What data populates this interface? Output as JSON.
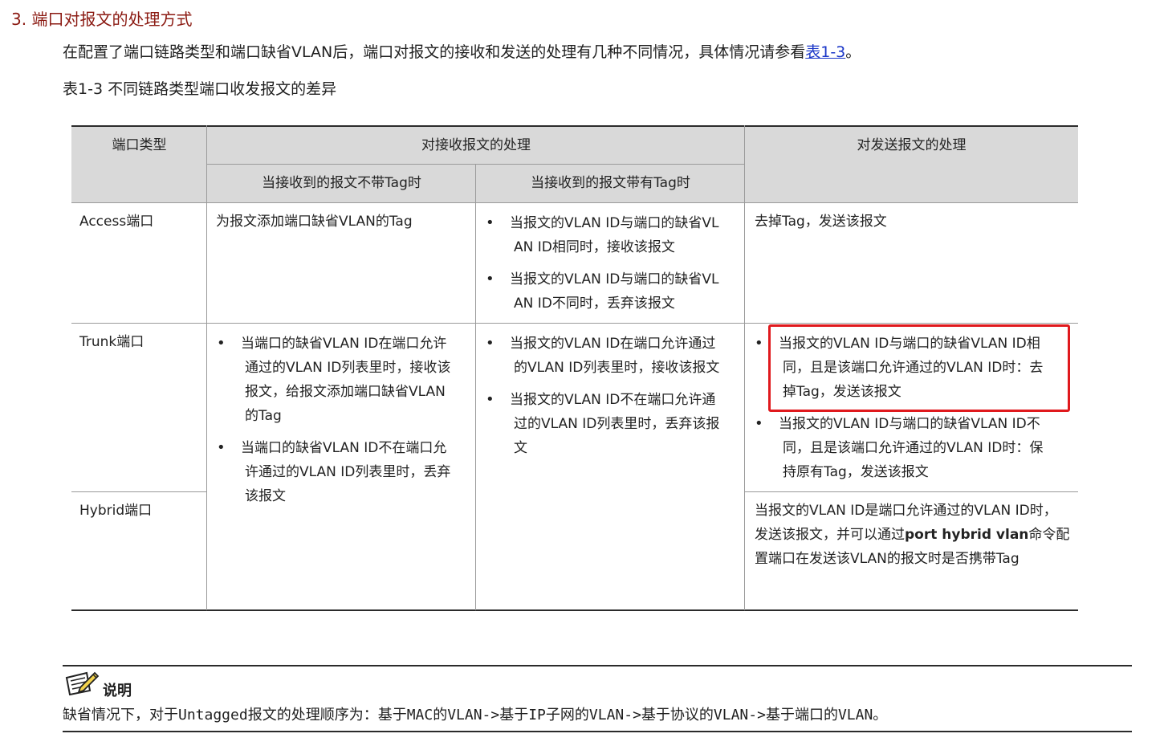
{
  "section_title": "3. 端口对报文的处理方式",
  "intro": {
    "text_before": "在配置了端口链路类型和端口缺省VLAN后，端口对报文的接收和发送的处理有几种不同情况，具体情况请参看",
    "link": "表1-3",
    "text_after": "。"
  },
  "table_caption": "表1-3 不同链路类型端口收发报文的差异",
  "table": {
    "headers": {
      "port_type": "端口类型",
      "receive": "对接收报文的处理",
      "receive_untagged": "当接收到的报文不带Tag时",
      "receive_tagged": "当接收到的报文带有Tag时",
      "send": "对发送报文的处理"
    },
    "rows": {
      "access": {
        "type": "Access端口",
        "untagged": "为报文添加端口缺省VLAN的Tag",
        "tagged": [
          [
            "当报文的VLAN ID与端口的缺省VL",
            "AN ID相同时，接收该报文"
          ],
          [
            "当报文的VLAN ID与端口的缺省VL",
            "AN ID不同时，丢弃该报文"
          ]
        ],
        "send": "去掉Tag，发送该报文"
      },
      "trunk": {
        "type": "Trunk端口",
        "tagged": [
          [
            "当报文的VLAN ID在端口允许通过",
            "的VLAN ID列表里时，接收该报文"
          ],
          [
            "当报文的VLAN ID不在端口允许通",
            "过的VLAN ID列表里时，丢弃该报",
            "文"
          ]
        ],
        "send": [
          [
            "当报文的VLAN ID与端口的缺省VLAN ID相",
            "同，且是该端口允许通过的VLAN ID时：去",
            "掉Tag，发送该报文"
          ],
          [
            "当报文的VLAN ID与端口的缺省VLAN ID不",
            "同，且是该端口允许通过的VLAN ID时：保",
            "持原有Tag，发送该报文"
          ]
        ]
      },
      "trunk_hybrid_untagged": [
        [
          "当端口的缺省VLAN ID在端口允许",
          "通过的VLAN ID列表里时，接收该",
          "报文，给报文添加端口缺省VLAN",
          "的Tag"
        ],
        [
          "当端口的缺省VLAN ID不在端口允",
          "许通过的VLAN ID列表里时，丢弃",
          "该报文"
        ]
      ],
      "hybrid": {
        "type": "Hybrid端口",
        "send_line1": "当报文的VLAN ID是端口允许通过的VLAN ID时，",
        "send_line2_pre": "发送该报文，并可以通过",
        "send_line2_cmd": "port hybrid vlan",
        "send_line2_post": "命令配",
        "send_line3": "置端口在发送该VLAN的报文时是否携带Tag"
      }
    }
  },
  "note": {
    "label": "说明",
    "text": "缺省情况下，对于Untagged报文的处理顺序为：基于MAC的VLAN->基于IP子网的VLAN->基于协议的VLAN->基于端口的VLAN。",
    "icon": "note-pencil-icon"
  },
  "colors": {
    "section_title": "#8b1a12",
    "link": "#1a36c8",
    "header_bg": "#d9d9d9",
    "highlight_box": "#e0191d"
  }
}
